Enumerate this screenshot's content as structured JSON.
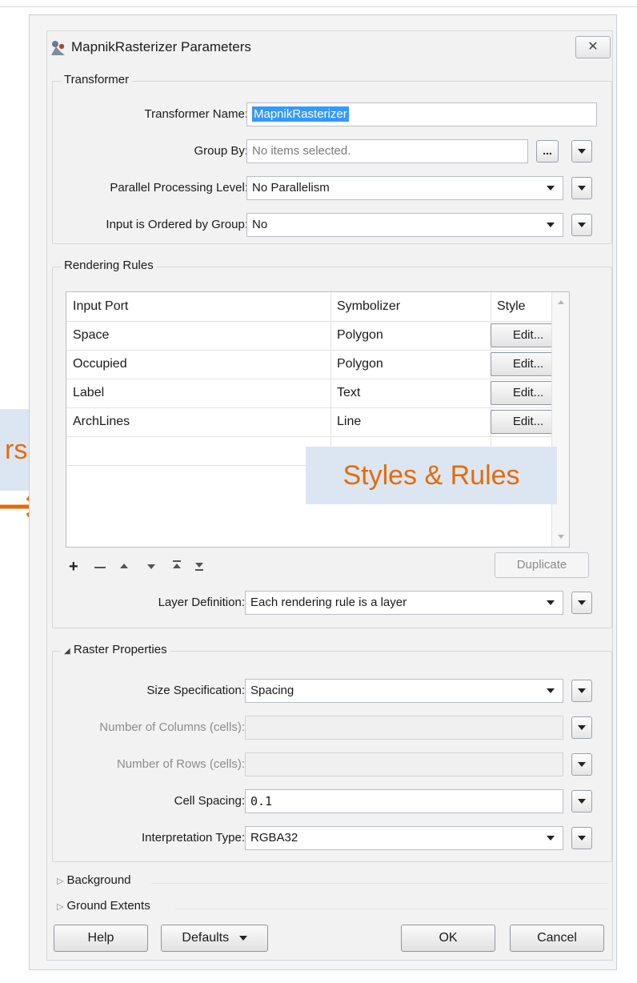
{
  "window": {
    "title": "MapnikRasterizer Parameters",
    "close_label": "✕"
  },
  "transformer": {
    "group_title": "Transformer",
    "name_label": "Transformer Name:",
    "name_value": "MapnikRasterizer",
    "groupby_label": "Group By:",
    "groupby_value": "No items selected.",
    "groupby_button": "...",
    "parallel_label": "Parallel Processing Level:",
    "parallel_value": "No Parallelism",
    "ordered_label": "Input is Ordered by Group:",
    "ordered_value": "No"
  },
  "rendering": {
    "group_title": "Rendering Rules",
    "columns": [
      "Input Port",
      "Symbolizer",
      "Style"
    ],
    "rows": [
      {
        "port": "Space",
        "symbolizer": "Polygon",
        "style": "Edit..."
      },
      {
        "port": "Occupied",
        "symbolizer": "Polygon",
        "style": "Edit..."
      },
      {
        "port": "Label",
        "symbolizer": "Text",
        "style": "Edit..."
      },
      {
        "port": "ArchLines",
        "symbolizer": "Line",
        "style": "Edit..."
      }
    ],
    "duplicate_label": "Duplicate",
    "layer_label": "Layer Definition:",
    "layer_value": "Each rendering rule is a layer"
  },
  "raster": {
    "group_title": "Raster Properties",
    "size_label": "Size Specification:",
    "size_value": "Spacing",
    "columns_label": "Number of Columns (cells):",
    "rows_label": "Number of Rows (cells):",
    "spacing_label": "Cell Spacing:",
    "spacing_value": "0.1",
    "interp_label": "Interpretation Type:",
    "interp_value": "RGBA32"
  },
  "sections": {
    "background": "Background",
    "ground": "Ground Extents"
  },
  "footer": {
    "help": "Help",
    "defaults": "Defaults",
    "ok": "OK",
    "cancel": "Cancel"
  },
  "callouts": {
    "styles_rules": "Styles & Rules",
    "left_fragment": "rs"
  },
  "colors": {
    "callout_bg": "#dce6f2",
    "callout_text": "#e36c09",
    "selection": "#3399ff"
  }
}
